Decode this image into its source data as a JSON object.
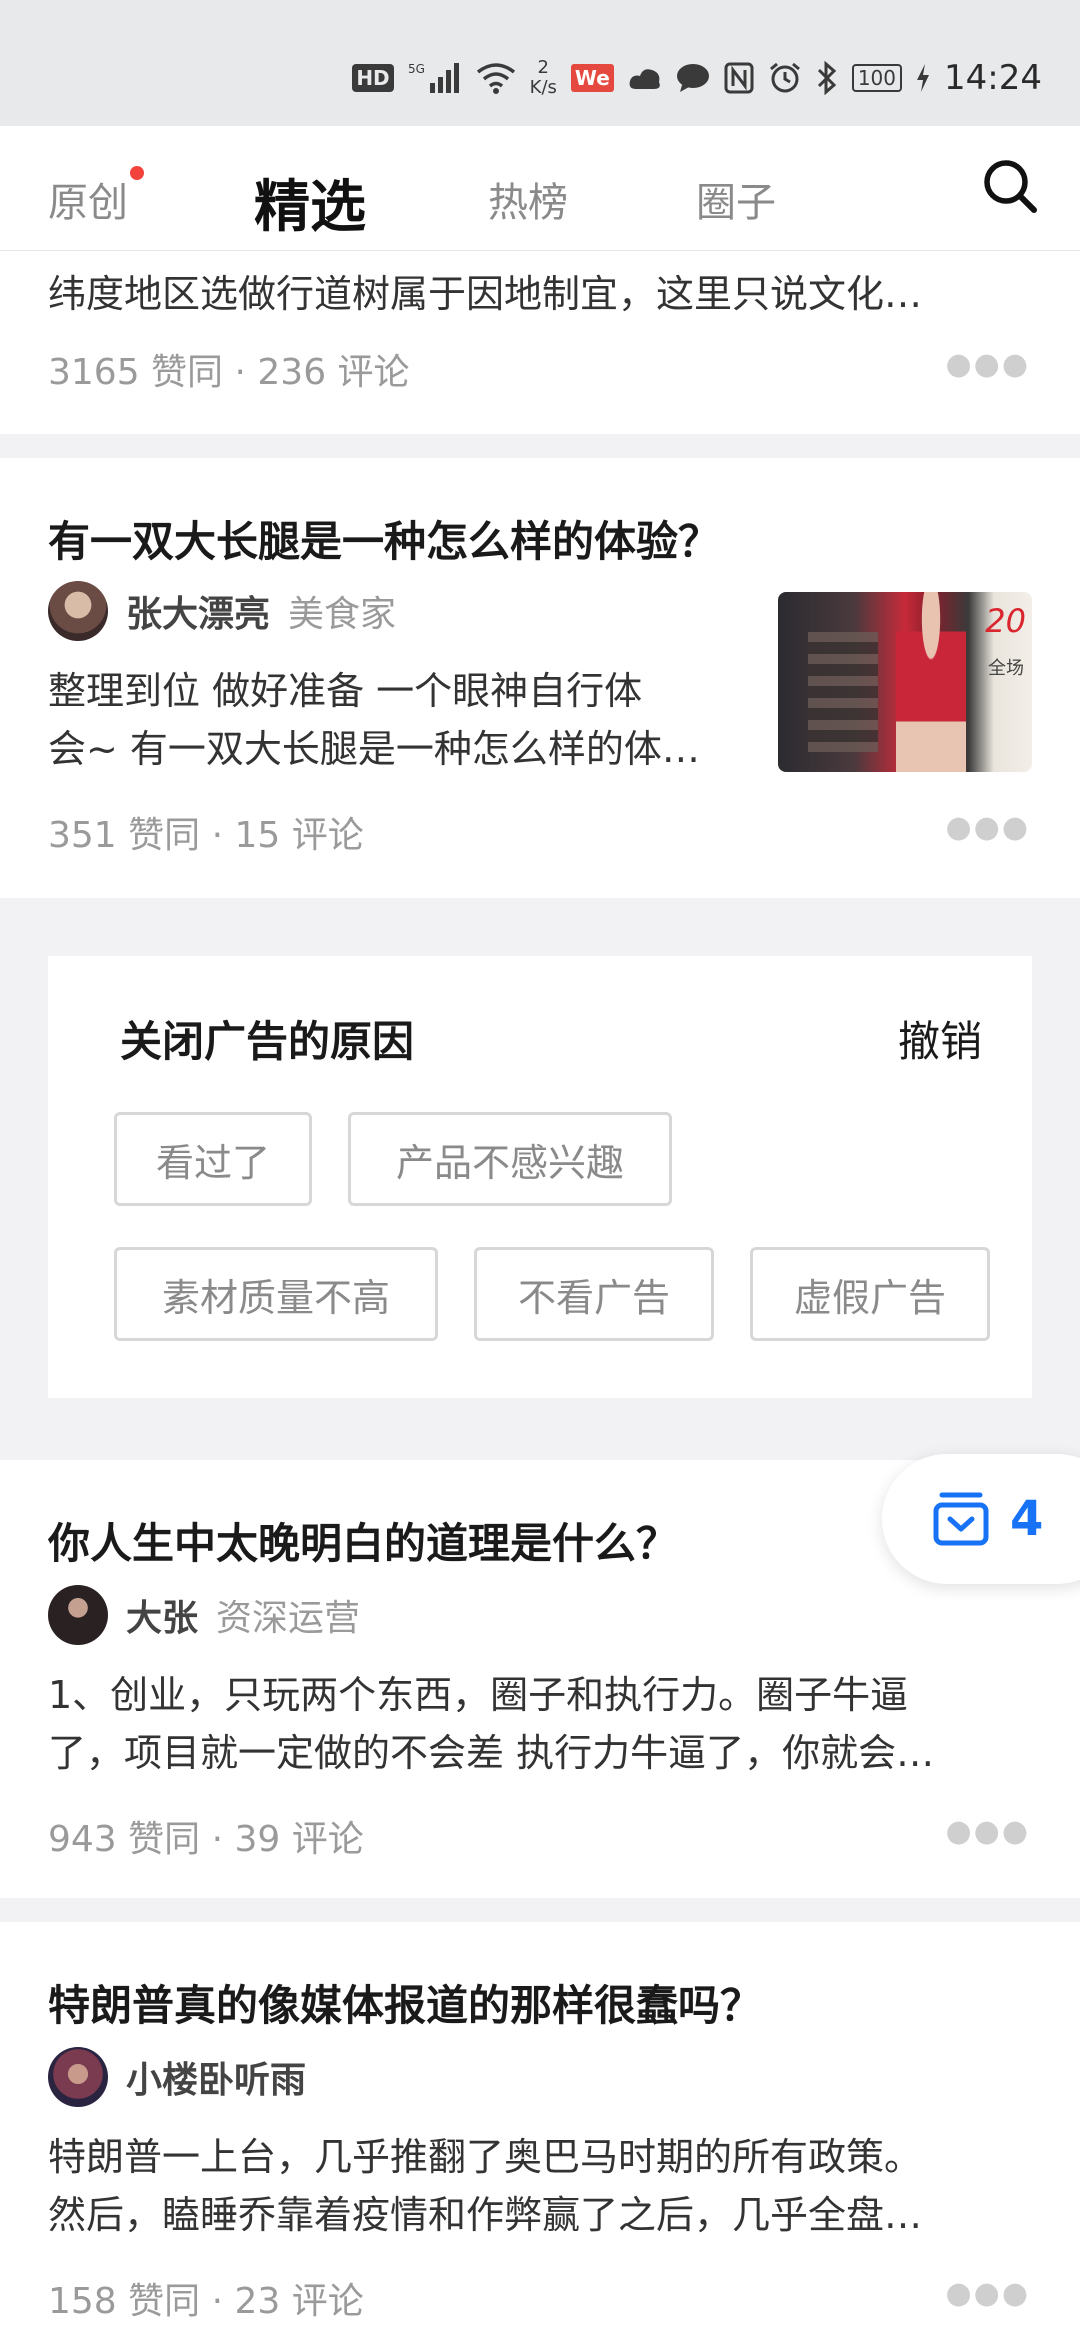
{
  "status_bar": {
    "hd": "HD",
    "net_speed_value": "2",
    "net_speed_unit": "K/s",
    "battery": "100",
    "time": "14:24"
  },
  "tabs": [
    {
      "label": "原创",
      "has_dot": true
    },
    {
      "label": "精选",
      "active": true
    },
    {
      "label": "热榜"
    },
    {
      "label": "圈子"
    }
  ],
  "feed": {
    "item0": {
      "excerpt": "纬度地区选做行道树属于因地制宜，这里只说文化…",
      "meta": "3165 赞同 · 236 评论"
    },
    "item1": {
      "title": "有一双大长腿是一种怎么样的体验？",
      "author": "张大漂亮",
      "author_tag": "美食家",
      "excerpt_line1": "整理到位 做好准备 一个眼神自行体",
      "excerpt_line2": "会~ 有一双大长腿是一种怎么样的体…",
      "meta": "351 赞同 · 15 评论",
      "thumb_text": "20",
      "thumb_sub": "全场"
    },
    "ad_close": {
      "title": "关闭广告的原因",
      "undo": "撤销",
      "reasons": [
        "看过了",
        "产品不感兴趣",
        "素材质量不高",
        "不看广告",
        "虚假广告"
      ]
    },
    "item2": {
      "title": "你人生中太晚明白的道理是什么？",
      "author": "大张",
      "author_tag": "资深运营",
      "excerpt_line1": "1、创业，只玩两个东西，圈子和执行力。圈子牛逼",
      "excerpt_line2": "了，项目就一定做的不会差 执行力牛逼了，你就会…",
      "meta": "943 赞同 · 39 评论"
    },
    "item3": {
      "title": "特朗普真的像媒体报道的那样很蠢吗？",
      "author": "小楼卧听雨",
      "excerpt_line1": "特朗普一上台，几乎推翻了奥巴马时期的所有政策。",
      "excerpt_line2": "然后，瞌睡乔靠着疫情和作弊赢了之后，几乎全盘…",
      "meta": "158 赞同 · 23 评论"
    }
  },
  "float_badge": {
    "count": "4",
    "icon": "inbox-icon"
  },
  "colors": {
    "accent": "#1772f6",
    "dot": "#f2443d"
  }
}
